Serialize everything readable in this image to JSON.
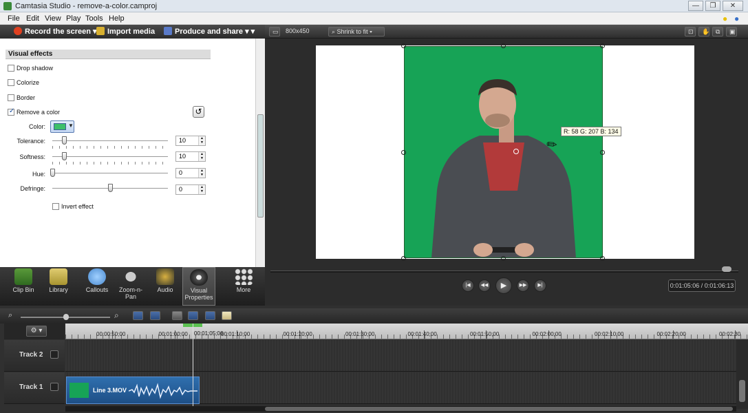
{
  "window": {
    "title": "Camtasia Studio - remove-a-color.camproj",
    "buttons": [
      "—",
      "❐",
      "✕"
    ]
  },
  "menu": {
    "items": [
      "File",
      "Edit",
      "View",
      "Play",
      "Tools",
      "Help"
    ]
  },
  "toolbar": {
    "record": "Record the screen ▾",
    "import": "Import media",
    "produce": "Produce and share ▾ ▾"
  },
  "visual_effects": {
    "header": "Visual effects",
    "effects": [
      {
        "label": "Drop shadow",
        "checked": false
      },
      {
        "label": "Colorize",
        "checked": false
      },
      {
        "label": "Border",
        "checked": false
      },
      {
        "label": "Remove a color",
        "checked": true
      }
    ],
    "color_label": "Color:",
    "color_value": "#3ec06a",
    "tolerance": {
      "label": "Tolerance:",
      "value": "10",
      "level": 0.1
    },
    "softness": {
      "label": "Softness:",
      "value": "10",
      "level": 0.1
    },
    "hue": {
      "label": "Hue:",
      "value": "0",
      "level": 0
    },
    "defringe": {
      "label": "Defringe:",
      "value": "0",
      "level": 0.5
    },
    "invert_label": "Invert effect"
  },
  "tabs": [
    {
      "label": "Clip Bin",
      "icon": "film-strip-icon"
    },
    {
      "label": "Library",
      "icon": "folder-icon"
    },
    {
      "label": "Callouts",
      "icon": "speech-bubble-icon"
    },
    {
      "label": "Zoom-n-\nPan",
      "icon": "magnifier-icon"
    },
    {
      "label": "Audio",
      "icon": "speaker-icon"
    },
    {
      "label": "Visual\nProperties",
      "icon": "visual-properties-icon"
    },
    {
      "label": "More",
      "icon": "more-dots-icon"
    }
  ],
  "preview": {
    "size": "800x450",
    "fit": "Shrink to fit",
    "tooltip": "R: 58  G: 207  B: 134",
    "timecode": "0:01:05:06 / 0:01:06:13",
    "progress": 0.975
  },
  "timeline": {
    "ruler": [
      "00:00:50;00",
      "00:01:00;00",
      "00:01:10;00",
      "00:01:20;00",
      "00:01:30;00",
      "00:01:40;00",
      "00:01:50;00",
      "00:02:00;00",
      "00:02:10;00",
      "00:02:20;00",
      "00:02:30"
    ],
    "playhead_time": "00:01:05;06",
    "tracks": [
      "Track 2",
      "Track 1"
    ],
    "clip_label": "Line 3.MOV"
  }
}
